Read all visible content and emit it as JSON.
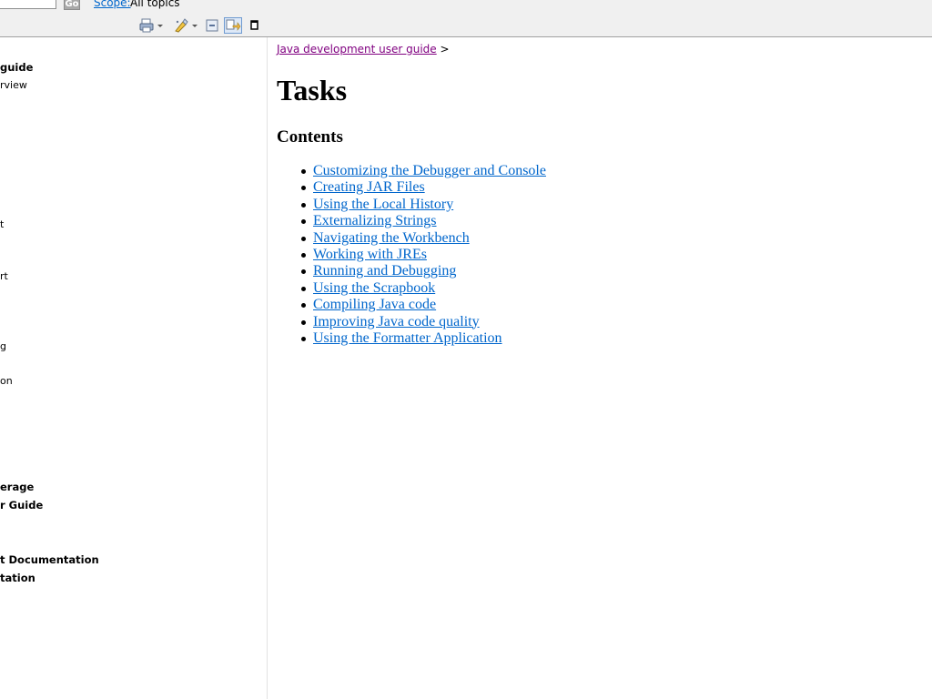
{
  "search": {
    "go_label": "Go",
    "scope_link": "Scope:",
    "scope_value": "All topics"
  },
  "toolbar": {
    "icons": [
      "print-icon",
      "highlight-icon",
      "collapse-all-icon",
      "link-with-contents-icon",
      "maximize-icon"
    ]
  },
  "nav": {
    "items": [
      {
        "label": "guide",
        "bold": true
      },
      {
        "label": "rview",
        "bold": false
      },
      {
        "label": "t",
        "bold": false
      },
      {
        "label": "rt",
        "bold": false
      },
      {
        "label": "g",
        "bold": false
      },
      {
        "label": "on",
        "bold": false
      },
      {
        "label": "erage",
        "bold": true
      },
      {
        "label": "r Guide",
        "bold": true
      },
      {
        "label": "t Documentation",
        "bold": true
      },
      {
        "label": "tation",
        "bold": true
      }
    ]
  },
  "content": {
    "breadcrumb": {
      "link": "Java development user guide",
      "separator": ">"
    },
    "title": "Tasks",
    "section_heading": "Contents",
    "topics": [
      "Customizing the Debugger and Console",
      "Creating JAR Files",
      "Using the Local History",
      "Externalizing Strings",
      "Navigating the Workbench",
      "Working with JREs",
      "Running and Debugging",
      "Using the Scrapbook",
      "Compiling Java code",
      "Improving Java code quality",
      "Using the Formatter Application"
    ]
  },
  "colors": {
    "link": "#0066cc",
    "visited_link": "#800080",
    "chrome": "#f0f0f0"
  }
}
